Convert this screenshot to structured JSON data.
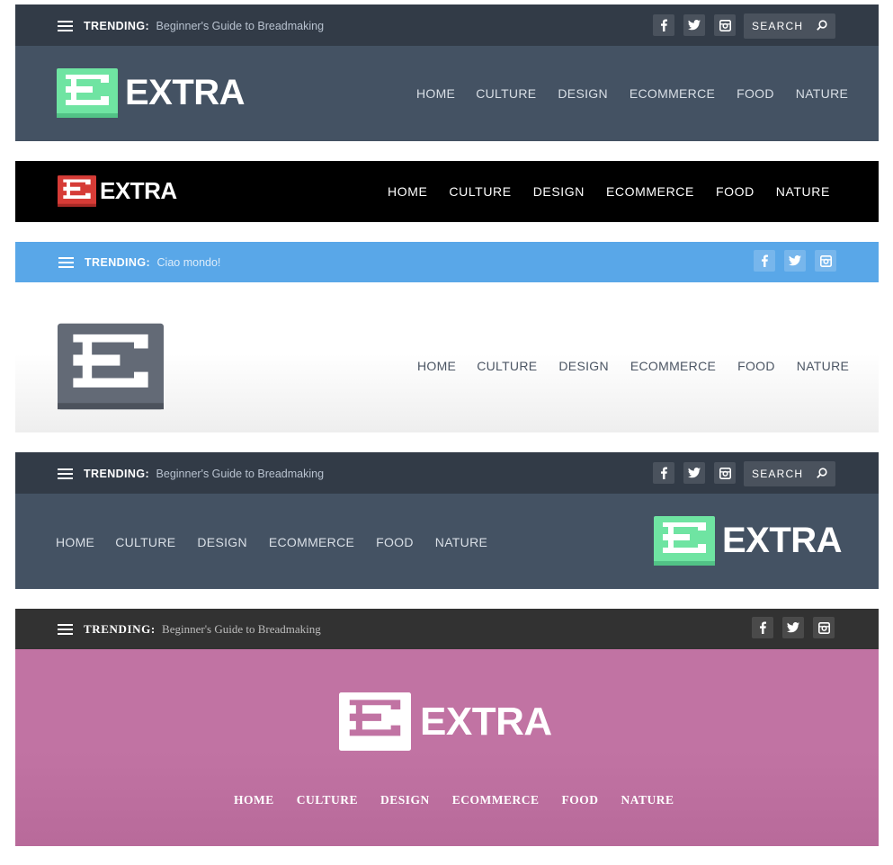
{
  "variants": [
    {
      "trending_label": "TRENDING:",
      "trending_text": "Beginner's Guide to Breadmaking",
      "search_placeholder": "SEARCH",
      "logo_text": "EXTRA",
      "nav": [
        "HOME",
        "CULTURE",
        "DESIGN",
        "ECOMMERCE",
        "FOOD",
        "NATURE"
      ]
    },
    {
      "logo_text": "EXTRA",
      "nav": [
        "HOME",
        "CULTURE",
        "DESIGN",
        "ECOMMERCE",
        "FOOD",
        "NATURE"
      ]
    },
    {
      "trending_label": "TRENDING:",
      "trending_text": "Ciao mondo!",
      "nav": [
        "HOME",
        "CULTURE",
        "DESIGN",
        "ECOMMERCE",
        "FOOD",
        "NATURE"
      ]
    },
    {
      "trending_label": "TRENDING:",
      "trending_text": "Beginner's Guide to Breadmaking",
      "search_placeholder": "SEARCH",
      "logo_text": "EXTRA",
      "nav": [
        "HOME",
        "CULTURE",
        "DESIGN",
        "ECOMMERCE",
        "FOOD",
        "NATURE"
      ]
    },
    {
      "trending_label": "TRENDING:",
      "trending_text": "Beginner's Guide to Breadmaking",
      "logo_text": "EXTRA",
      "nav": [
        "HOME",
        "CULTURE",
        "DESIGN",
        "ECOMMERCE",
        "FOOD",
        "NATURE"
      ]
    }
  ],
  "icons": [
    "hamburger-icon",
    "facebook-icon",
    "twitter-icon",
    "instagram-icon",
    "search-icon",
    "extra-logo-icon"
  ],
  "colors": {
    "topbar_slate": "#323b47",
    "header_slate": "#445263",
    "logo_green": "#6fe4a2",
    "logo_red": "#d63c37",
    "black": "#000000",
    "trend_blue": "#59a7e8",
    "logo_gray": "#636a76",
    "dark_bar": "#323232",
    "pink": "#c173a3"
  }
}
